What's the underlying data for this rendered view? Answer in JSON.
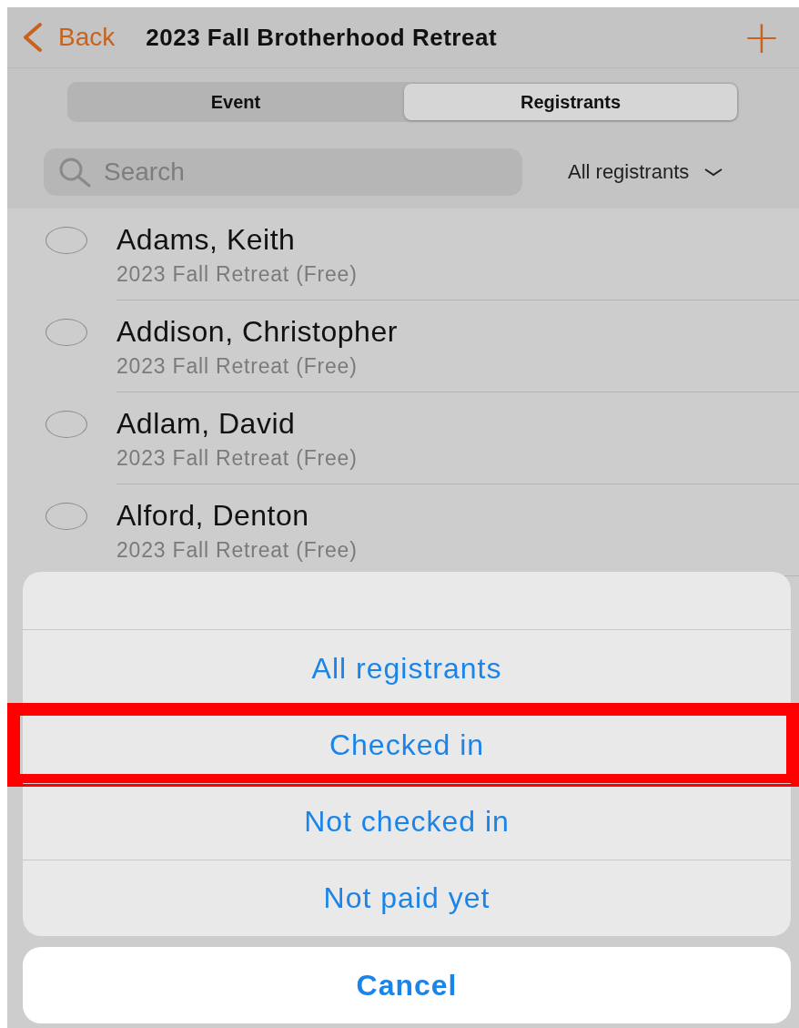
{
  "nav": {
    "back": "Back",
    "title": "2023 Fall Brotherhood Retreat",
    "add": "+"
  },
  "tabs": [
    {
      "label": "Event",
      "selected": false
    },
    {
      "label": "Registrants",
      "selected": true
    }
  ],
  "search": {
    "placeholder": "Search"
  },
  "filter": {
    "label": "All registrants"
  },
  "registrants": [
    {
      "name": "Adams, Keith",
      "detail": "2023 Fall Retreat (Free)",
      "checked": false
    },
    {
      "name": "Addison, Christopher",
      "detail": "2023 Fall Retreat (Free)",
      "checked": false
    },
    {
      "name": "Adlam, David",
      "detail": "2023 Fall Retreat (Free)",
      "checked": false
    },
    {
      "name": "Alford, Denton",
      "detail": "2023 Fall Retreat (Free)",
      "checked": false
    }
  ],
  "sheet": {
    "options": [
      {
        "label": "All registrants",
        "highlighted": false
      },
      {
        "label": "Checked in",
        "highlighted": true
      },
      {
        "label": "Not checked in",
        "highlighted": false
      },
      {
        "label": "Not paid yet",
        "highlighted": false
      }
    ],
    "cancel": "Cancel"
  }
}
